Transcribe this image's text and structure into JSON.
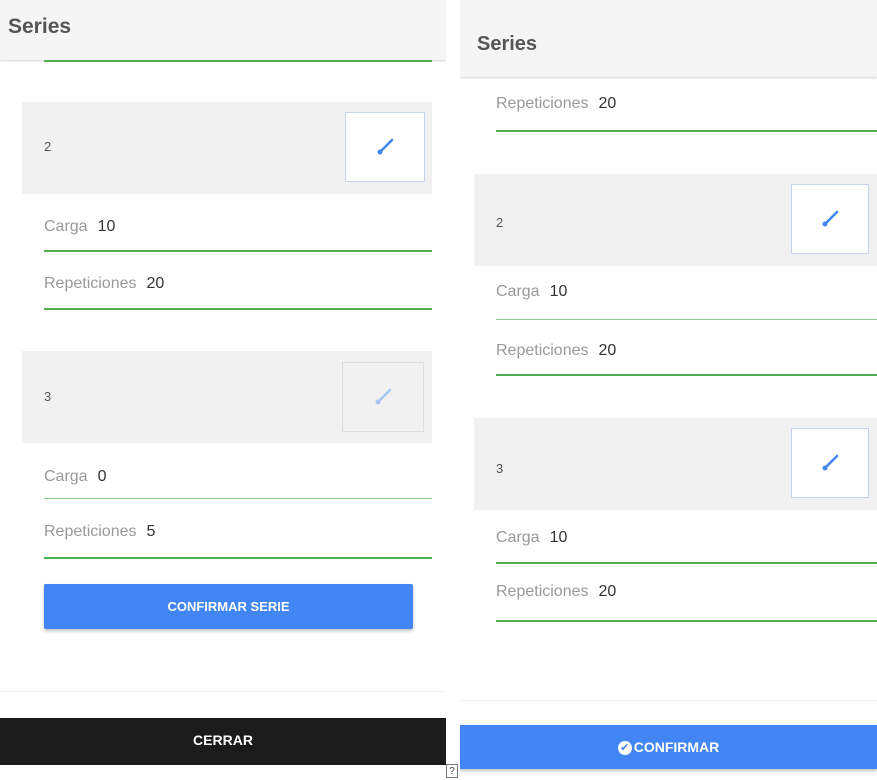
{
  "left": {
    "title": "Series",
    "sets": [
      {
        "number": "2",
        "edit_enabled": true,
        "carga_label": "Carga",
        "carga_value": "10",
        "reps_label": "Repeticiones",
        "reps_value": "20"
      },
      {
        "number": "3",
        "edit_enabled": false,
        "carga_label": "Carga",
        "carga_value": "0",
        "reps_label": "Repeticiones",
        "reps_value": "5"
      }
    ],
    "confirm_label": "CONFIRMAR SERIE",
    "close_label": "CERRAR"
  },
  "right": {
    "title": "Series",
    "partial_reps_label": "Repeticiones",
    "partial_reps_value": "20",
    "sets": [
      {
        "number": "2",
        "edit_enabled": true,
        "carga_label": "Carga",
        "carga_value": "10",
        "reps_label": "Repeticiones",
        "reps_value": "20"
      },
      {
        "number": "3",
        "edit_enabled": true,
        "carga_label": "Carga",
        "carga_value": "10",
        "reps_label": "Repeticiones",
        "reps_value": "20"
      }
    ],
    "confirm_label": "CONFIRMAR"
  },
  "help_glyph": "?",
  "colors": {
    "accent": "#4285f4",
    "field_underline": "#4caf50",
    "dark_button": "#1b1b1b"
  }
}
